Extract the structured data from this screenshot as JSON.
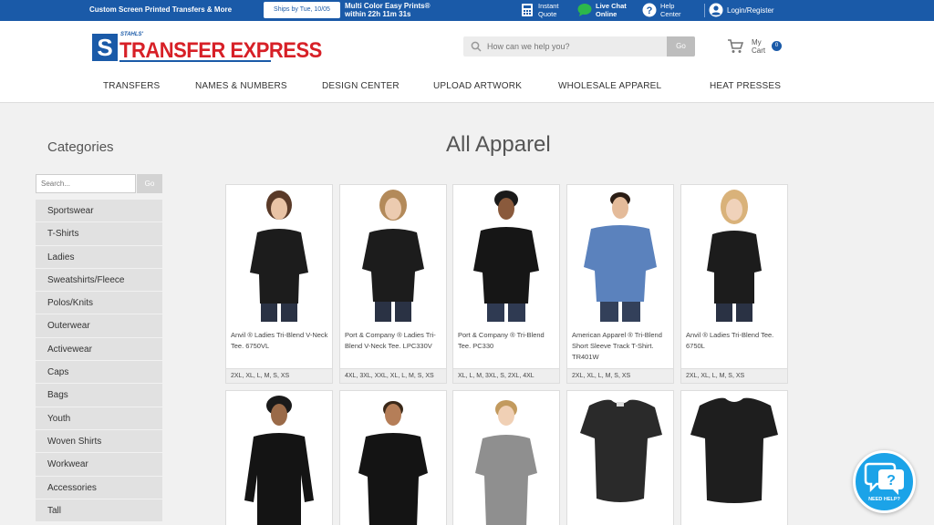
{
  "topbar": {
    "promo": "Custom Screen Printed Transfers & More",
    "ships_by": "Ships by Tue, 10/05",
    "multi_line1": "Multi Color Easy Prints®",
    "multi_line2": "within 22h 11m 31s",
    "instant_quote_1": "Instant",
    "instant_quote_2": "Quote",
    "live_chat_1": "Live Chat",
    "live_chat_2": "Online",
    "help_center_1": "Help",
    "help_center_2": "Center",
    "login": "Login/Register"
  },
  "logo": {
    "stahls": "STAHLS'",
    "name": "TRANSFER EXPRESS",
    "s_letter": "S"
  },
  "search": {
    "placeholder": "How can we help you?",
    "go": "Go"
  },
  "cart": {
    "line1": "My",
    "line2": "Cart",
    "count": "0"
  },
  "nav": [
    "TRANSFERS",
    "NAMES & NUMBERS",
    "DESIGN CENTER",
    "UPLOAD ARTWORK",
    "WHOLESALE APPAREL",
    "HEAT PRESSES"
  ],
  "sidebar": {
    "title": "Categories",
    "search_placeholder": "Search...",
    "go": "Go",
    "categories": [
      "Sportswear",
      "T-Shirts",
      "Ladies",
      "Sweatshirts/Fleece",
      "Polos/Knits",
      "Outerwear",
      "Activewear",
      "Caps",
      "Bags",
      "Youth",
      "Woven Shirts",
      "Workwear",
      "Accessories",
      "Tall"
    ]
  },
  "main": {
    "title": "All Apparel",
    "products": [
      {
        "name": "Anvil ® Ladies Tri-Blend V-Neck Tee. 6750VL",
        "sizes": "2XL, XL, L, M, S, XS"
      },
      {
        "name": "Port & Company ® Ladies Tri-Blend V-Neck Tee. LPC330V",
        "sizes": "4XL, 3XL, XXL, XL, L, M, S, XS"
      },
      {
        "name": "Port & Company ® Tri-Blend Tee. PC330",
        "sizes": "XL, L, M, 3XL, S, 2XL, 4XL"
      },
      {
        "name": "American Apparel ® Tri-Blend Short Sleeve Track T-Shirt. TR401W",
        "sizes": "2XL, XL, L, M, S, XS"
      },
      {
        "name": "Anvil ® Ladies Tri-Blend Tee. 6750L",
        "sizes": "2XL, XL, L, M, S, XS"
      }
    ]
  },
  "help_bubble": {
    "label": "NEED HELP?"
  },
  "colors": {
    "brand_blue": "#1a5aa8",
    "brand_red": "#d72027",
    "chat_blue": "#1ba3e8"
  }
}
